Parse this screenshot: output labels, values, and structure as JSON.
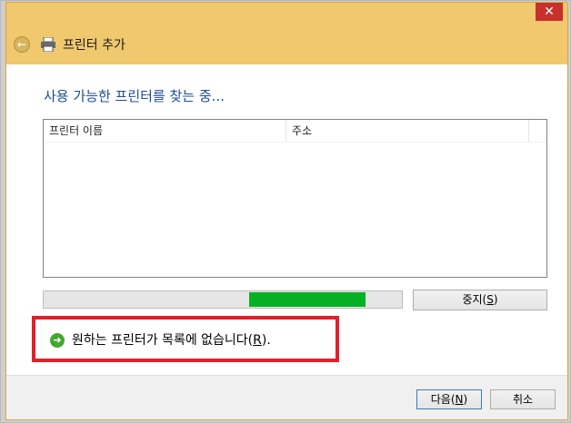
{
  "window": {
    "title": "프린터 추가",
    "close_glyph": "✕"
  },
  "page": {
    "heading": "사용 가능한 프린터를 찾는 중..."
  },
  "list": {
    "columns": [
      "프린터 이름",
      "주소"
    ],
    "rows": []
  },
  "progress": {
    "state": "indeterminate",
    "fill_color": "#06b025"
  },
  "buttons": {
    "stop_label": "중지",
    "stop_key": "S",
    "next_label": "다음",
    "next_key": "N",
    "cancel_label": "취소"
  },
  "link": {
    "text": "원하는 프린터가 목록에 없습니다",
    "key": "R",
    "suffix": "."
  },
  "annotation": {
    "highlight_color": "#e1202a"
  }
}
